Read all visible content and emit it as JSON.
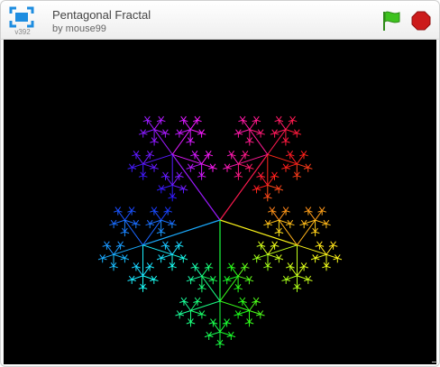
{
  "header": {
    "version_label": "v392",
    "project_title": "Pentagonal Fractal",
    "project_author": "by mouse99"
  },
  "colors": {
    "flag": "#3ec21f",
    "stop": "#cc1b1b",
    "fullscreen": "#1e8de0",
    "stage_background": "#000000"
  },
  "icons": {
    "fullscreen": "fullscreen-icon",
    "flag": "green-flag-icon",
    "stop": "stop-sign-icon"
  },
  "stage": {
    "fractal": "pentaflake",
    "depth": 4
  }
}
